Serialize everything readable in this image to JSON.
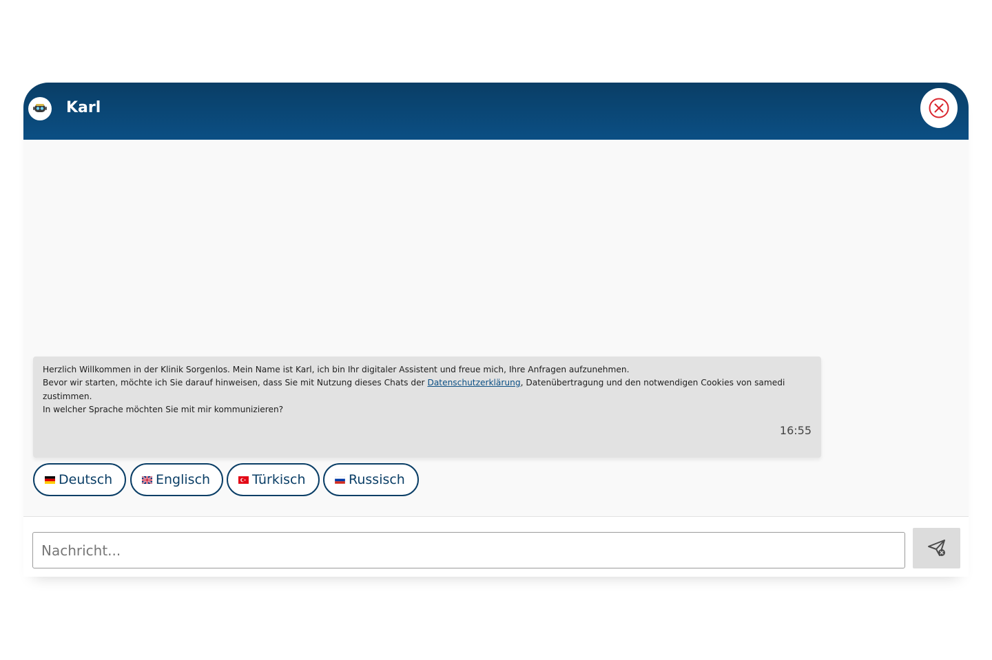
{
  "header": {
    "title": "Karl",
    "avatar_icon": "robot-icon",
    "close_icon": "close-circle-icon",
    "gradient_top": "#0a3e66",
    "gradient_bottom": "#0b4f84"
  },
  "message": {
    "line1": "Herzlich Willkommen in der Klinik Sorgenlos. Mein Name ist Karl, ich bin Ihr digitaler Assistent und freue mich, Ihre Anfragen aufzunehmen.",
    "line2_before": "Bevor wir starten, möchte ich Sie darauf hinweisen, dass Sie mit Nutzung dieses Chats der ",
    "line2_link": "Datenschutzerklärung",
    "line2_after": ", Datenübertragung und den notwendigen Cookies von samedi zustimmen.",
    "line3": "In welcher Sprache möchten Sie mit mir kommunizieren?",
    "timestamp": "16:55"
  },
  "languages": [
    {
      "label": "Deutsch",
      "flag": "germany-flag-icon"
    },
    {
      "label": "Englisch",
      "flag": "uk-flag-icon"
    },
    {
      "label": "Türkisch",
      "flag": "turkey-flag-icon"
    },
    {
      "label": "Russisch",
      "flag": "russia-flag-icon"
    }
  ],
  "input": {
    "placeholder": "Nachricht...",
    "value": "",
    "send_icon": "send-icon"
  },
  "colors": {
    "accent": "#0a3e66",
    "close_red": "#d9262e",
    "bubble_bg": "#e2e2e2"
  }
}
